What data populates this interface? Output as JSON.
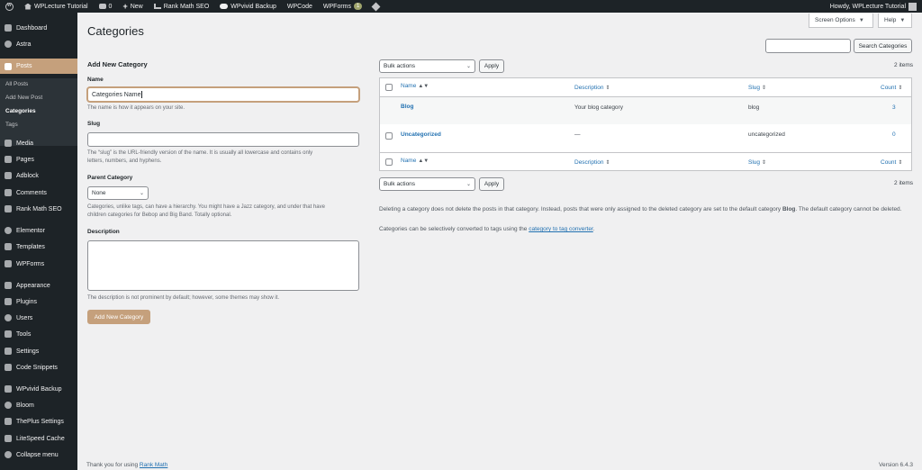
{
  "adminbar": {
    "site_name": "WPLecture Tutorial",
    "comments_count": "0",
    "new_label": "New",
    "rank_math": "Rank Math SEO",
    "wpvivid": "WPvivid Backup",
    "wpcode": "WPCode",
    "wpforms": "WPForms",
    "wpforms_badge": "1",
    "greeting": "Howdy, WPLecture Tutorial"
  },
  "sidebar": {
    "items": [
      {
        "label": "Dashboard",
        "icon": "dashboard-icon"
      },
      {
        "label": "Astra",
        "icon": "astra-icon"
      },
      {
        "label": "Posts",
        "icon": "pin-icon"
      },
      {
        "label": "Media",
        "icon": "media-icon"
      },
      {
        "label": "Pages",
        "icon": "pages-icon"
      },
      {
        "label": "Adblock",
        "icon": "adblock-icon"
      },
      {
        "label": "Comments",
        "icon": "comments-icon"
      },
      {
        "label": "Rank Math SEO",
        "icon": "rankmath-icon"
      },
      {
        "label": "Elementor",
        "icon": "elementor-icon"
      },
      {
        "label": "Templates",
        "icon": "templates-icon"
      },
      {
        "label": "WPForms",
        "icon": "wpforms-icon"
      },
      {
        "label": "Appearance",
        "icon": "appearance-icon"
      },
      {
        "label": "Plugins",
        "icon": "plugins-icon"
      },
      {
        "label": "Users",
        "icon": "users-icon"
      },
      {
        "label": "Tools",
        "icon": "tools-icon"
      },
      {
        "label": "Settings",
        "icon": "settings-icon"
      },
      {
        "label": "Code Snippets",
        "icon": "code-snippets-icon"
      },
      {
        "label": "WPvivid Backup",
        "icon": "wpvivid-icon"
      },
      {
        "label": "Bloom",
        "icon": "bloom-icon"
      },
      {
        "label": "ThePlus Settings",
        "icon": "theplus-icon"
      },
      {
        "label": "LiteSpeed Cache",
        "icon": "litespeed-icon"
      },
      {
        "label": "Collapse menu",
        "icon": "collapse-icon"
      }
    ],
    "submenu": [
      "All Posts",
      "Add New Post",
      "Categories",
      "Tags"
    ]
  },
  "top_buttons": {
    "screen_options": "Screen Options",
    "help": "Help"
  },
  "page_title": "Categories",
  "search": {
    "value": "",
    "button": "Search Categories"
  },
  "form": {
    "heading": "Add New Category",
    "name_label": "Name",
    "name_value": "Categories Name",
    "name_desc": "The name is how it appears on your site.",
    "slug_label": "Slug",
    "slug_value": "",
    "slug_desc_1": "The “slug” is the URL-friendly version of the name. It is usually all lowercase and contains only",
    "slug_desc_2": "letters, numbers, and hyphens.",
    "parent_label": "Parent Category",
    "parent_value": "None",
    "parent_desc_1": "Categories, unlike tags, can have a hierarchy. You might have a Jazz category, and under that have",
    "parent_desc_2": "children categories for Bebop and Big Band. Totally optional.",
    "description_label": "Description",
    "description_desc": "The description is not prominent by default; however, some themes may show it.",
    "submit": "Add New Category"
  },
  "bulk": {
    "label": "Bulk actions",
    "apply": "Apply",
    "items_count": "2 items"
  },
  "table": {
    "headers": {
      "name": "Name",
      "description": "Description",
      "slug": "Slug",
      "count": "Count"
    },
    "rows": [
      {
        "name": "Blog",
        "description": "Your blog category",
        "slug": "blog",
        "count": "3"
      },
      {
        "name": "Uncategorized",
        "description": "—",
        "slug": "uncategorized",
        "count": "0"
      }
    ]
  },
  "notes": {
    "note1_a": "Deleting a category does not delete the posts in that category. Instead, posts that were only assigned to the deleted category are set to the default category",
    "note1_bold": "Blog",
    "note1_b": ". The default category cannot be",
    "note1_c": "deleted.",
    "note2_a": "Categories can be selectively converted to tags using the",
    "note2_link": "category to tag converter",
    "note2_b": "."
  },
  "footer": {
    "thanks": "Thank you for using",
    "rank_math": "Rank Math",
    "version": "Version 6.4.3"
  },
  "colors": {
    "accent": "#c5a07c",
    "sidebar_bg": "#1d2327",
    "link": "#2271b1"
  }
}
